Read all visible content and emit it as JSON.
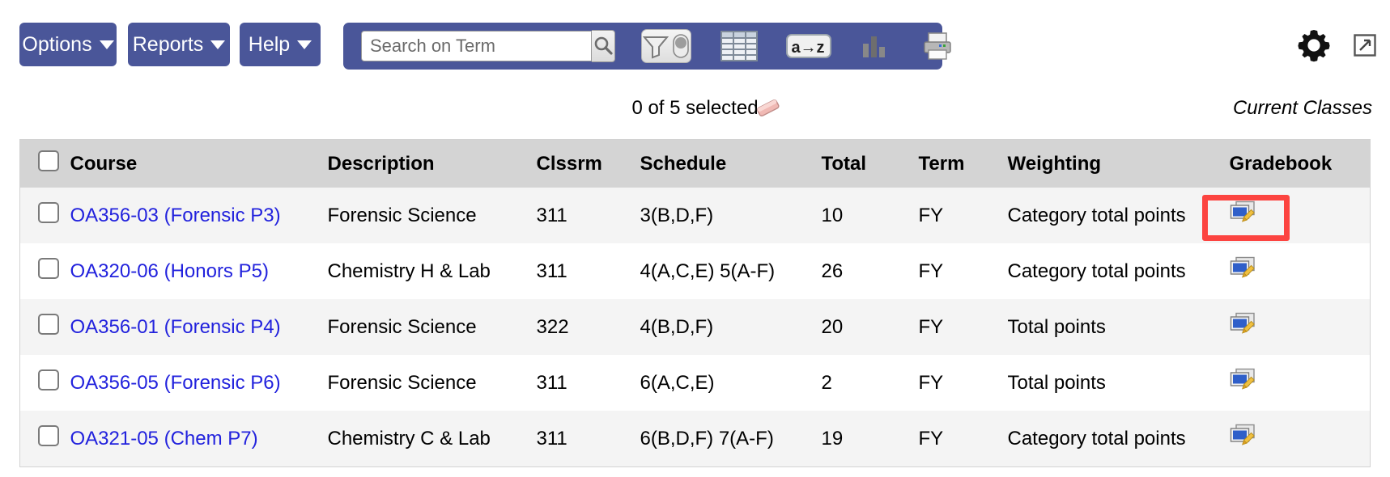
{
  "toolbar": {
    "options_label": "Options",
    "reports_label": "Reports",
    "help_label": "Help",
    "search_placeholder": "Search on Term",
    "search_value": "",
    "icons": {
      "search": "search-icon",
      "filter": "filter-icon",
      "grid": "table-grid-icon",
      "sort": "a-z-sort-icon",
      "chart": "bar-chart-icon",
      "print": "printer-icon",
      "gear": "gear-icon",
      "popout": "open-in-new-window-icon"
    },
    "colors": {
      "toolbar_blue": "#4a5699",
      "link_blue": "#2222dd",
      "highlight_red": "#fc4440",
      "header_gray": "#d4d4d4"
    }
  },
  "status": {
    "selected_text": "0 of 5 selected",
    "eraser_icon": "eraser-icon",
    "view_label": "Current Classes"
  },
  "table": {
    "columns": [
      "",
      "Course",
      "Description",
      "Clssrm",
      "Schedule",
      "Total",
      "Term",
      "Weighting",
      "Gradebook"
    ],
    "rows": [
      {
        "course": "OA356-03 (Forensic P3)",
        "description": "Forensic Science",
        "clssrm": "311",
        "schedule": "3(B,D,F)",
        "total": "10",
        "term": "FY",
        "weighting": "Category total points",
        "gradebook_icon": "gradebook-edit-icon",
        "highlighted": true
      },
      {
        "course": "OA320-06 (Honors P5)",
        "description": "Chemistry H & Lab",
        "clssrm": "311",
        "schedule": "4(A,C,E) 5(A-F)",
        "total": "26",
        "term": "FY",
        "weighting": "Category total points",
        "gradebook_icon": "gradebook-edit-icon",
        "highlighted": false
      },
      {
        "course": "OA356-01 (Forensic P4)",
        "description": "Forensic Science",
        "clssrm": "322",
        "schedule": "4(B,D,F)",
        "total": "20",
        "term": "FY",
        "weighting": "Total points",
        "gradebook_icon": "gradebook-edit-icon",
        "highlighted": false
      },
      {
        "course": "OA356-05 (Forensic P6)",
        "description": "Forensic Science",
        "clssrm": "311",
        "schedule": "6(A,C,E)",
        "total": "2",
        "term": "FY",
        "weighting": "Total points",
        "gradebook_icon": "gradebook-edit-icon",
        "highlighted": false
      },
      {
        "course": "OA321-05 (Chem P7)",
        "description": "Chemistry C & Lab",
        "clssrm": "311",
        "schedule": "6(B,D,F) 7(A-F)",
        "total": "19",
        "term": "FY",
        "weighting": "Category total points",
        "gradebook_icon": "gradebook-edit-icon",
        "highlighted": false
      }
    ]
  }
}
